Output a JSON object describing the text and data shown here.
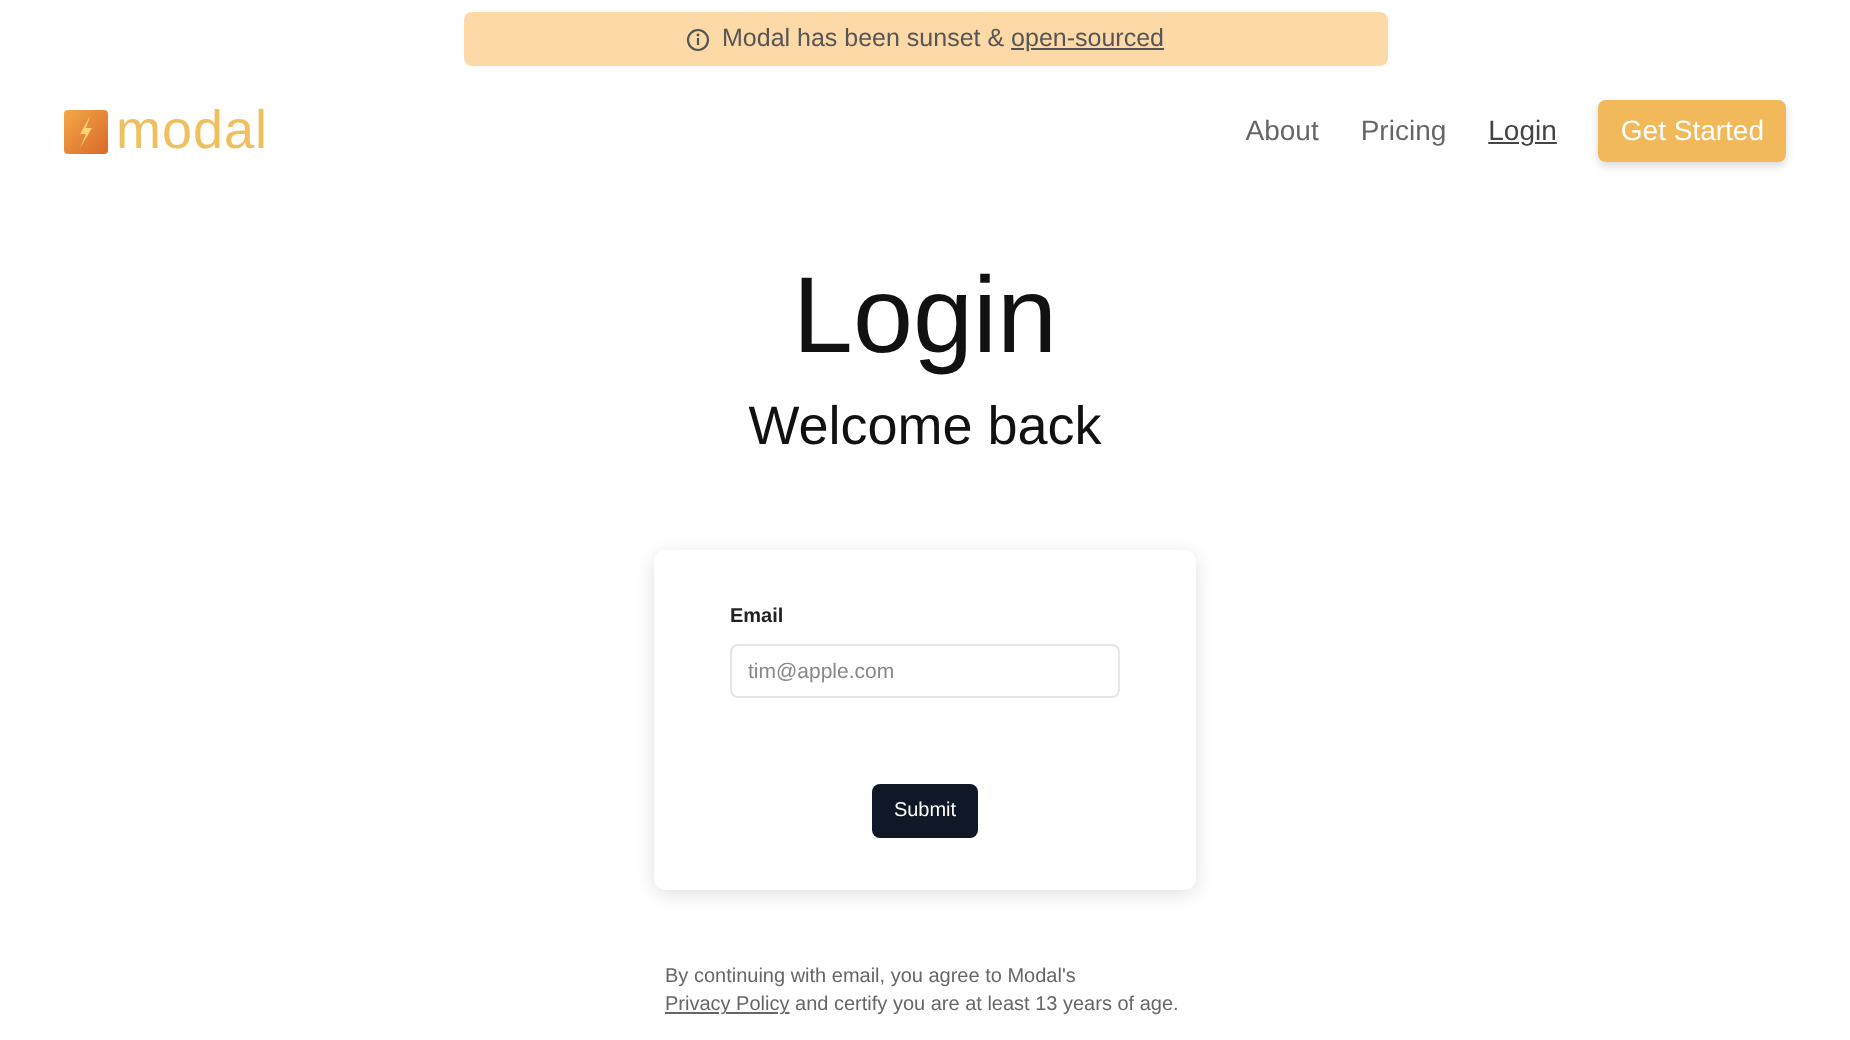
{
  "banner": {
    "text": "Modal has been sunset & ",
    "link": "open-sourced"
  },
  "logo": {
    "text": "modal"
  },
  "nav": [
    {
      "label": "About",
      "selected": false
    },
    {
      "label": "Pricing",
      "selected": false
    },
    {
      "label": "Login",
      "selected": true
    }
  ],
  "cta_button": "Get Started",
  "heading": "Login",
  "subheading": "Welcome back",
  "form": {
    "label": "Email",
    "placeholder": "tim@apple.com",
    "submit": "Submit"
  },
  "footer": {
    "before": "By continuing with email, you agree to Modal's ",
    "link": "Privacy Policy",
    "after": " and certify you are at least 13 years of age."
  }
}
